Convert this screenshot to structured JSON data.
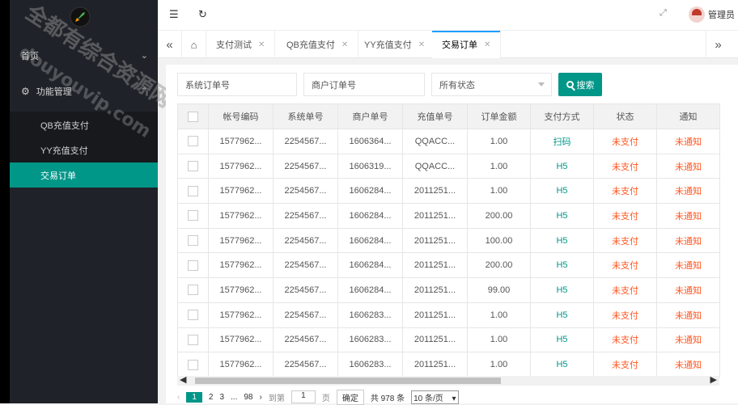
{
  "sidebar": {
    "home": "首页",
    "feature_group": "功能管理",
    "submenu": [
      "QB充值支付",
      "YY充值支付",
      "交易订单"
    ]
  },
  "header": {
    "admin_label": "管理员"
  },
  "tabs": [
    {
      "label": "支付测试"
    },
    {
      "label": "QB充值支付"
    },
    {
      "label": "YY充值支付"
    },
    {
      "label": "交易订单",
      "active": true
    }
  ],
  "filters": {
    "system_order_placeholder": "系统订单号",
    "merchant_order_placeholder": "商户订单号",
    "status_select": "所有状态",
    "search_button": "搜索"
  },
  "table": {
    "headers": [
      "帐号编码",
      "系统单号",
      "商户单号",
      "充值单号",
      "订单金额",
      "支付方式",
      "状态",
      "通知"
    ],
    "rows": [
      [
        "1577962...",
        "2254567...",
        "1606364...",
        "QQACC...",
        "1.00",
        "扫码",
        "未支付",
        "未通知"
      ],
      [
        "1577962...",
        "2254567...",
        "1606319...",
        "QQACC...",
        "1.00",
        "H5",
        "未支付",
        "未通知"
      ],
      [
        "1577962...",
        "2254567...",
        "1606284...",
        "2011251...",
        "1.00",
        "H5",
        "未支付",
        "未通知"
      ],
      [
        "1577962...",
        "2254567...",
        "1606284...",
        "2011251...",
        "200.00",
        "H5",
        "未支付",
        "未通知"
      ],
      [
        "1577962...",
        "2254567...",
        "1606284...",
        "2011251...",
        "100.00",
        "H5",
        "未支付",
        "未通知"
      ],
      [
        "1577962...",
        "2254567...",
        "1606284...",
        "2011251...",
        "200.00",
        "H5",
        "未支付",
        "未通知"
      ],
      [
        "1577962...",
        "2254567...",
        "1606284...",
        "2011251...",
        "99.00",
        "H5",
        "未支付",
        "未通知"
      ],
      [
        "1577962...",
        "2254567...",
        "1606283...",
        "2011251...",
        "1.00",
        "H5",
        "未支付",
        "未通知"
      ],
      [
        "1577962...",
        "2254567...",
        "1606283...",
        "2011251...",
        "1.00",
        "H5",
        "未支付",
        "未通知"
      ],
      [
        "1577962...",
        "2254567...",
        "1606283...",
        "2011251...",
        "1.00",
        "H5",
        "未支付",
        "未通知"
      ]
    ]
  },
  "pagination": {
    "current": "1",
    "pages": [
      "2",
      "3"
    ],
    "ellipsis": "...",
    "last": "98",
    "goto_label": "到第",
    "goto_value": "1",
    "page_suffix": "页",
    "confirm": "确定",
    "total": "共 978 条",
    "page_size": "10 条/页"
  },
  "watermark": {
    "line1": "全都有综合资源网",
    "line2": "douyouvip.com"
  },
  "colors": {
    "accent": "#009688",
    "sidebar_bg": "#1f2329",
    "status_red": "#ff5722"
  }
}
